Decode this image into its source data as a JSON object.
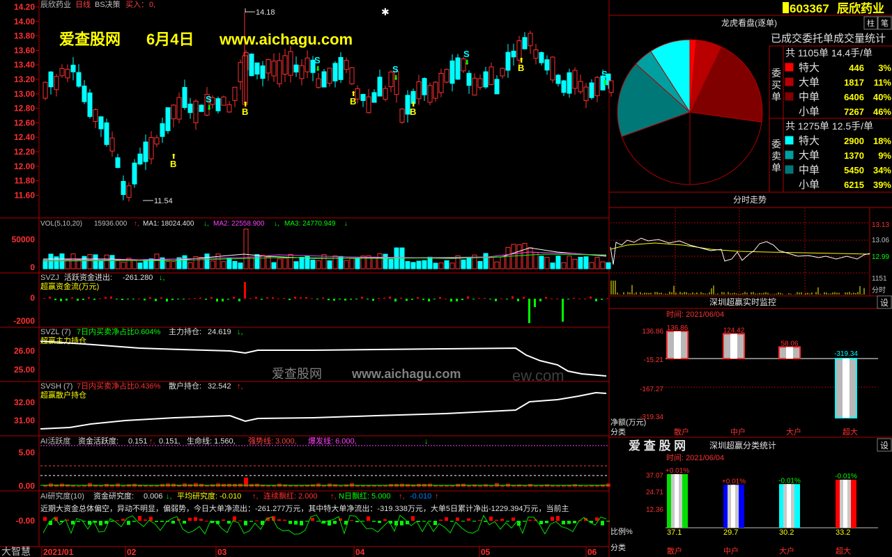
{
  "stock": {
    "name": "辰欣药业",
    "code": "603367",
    "title_name": "辰欣药业",
    "period": "日线",
    "strategy": "BS决策",
    "buy_label": "买入：",
    "buy_value": "0,"
  },
  "watermark": {
    "site": "爱查股网",
    "date": "6月4日",
    "url": "www.aichagu.com",
    "center_site": "爱查股网",
    "center_url": "www.aichagu.com",
    "center_suffix": "ew.com",
    "logo": "爱 查 股 网"
  },
  "price_axis": [
    "14.20",
    "14.00",
    "13.80",
    "13.60",
    "13.40",
    "13.20",
    "13.00",
    "12.80",
    "12.60",
    "12.40",
    "12.20",
    "12.00",
    "11.80",
    "11.60"
  ],
  "price_high_label": "14.18",
  "price_low_label": "11.54",
  "vol_header": {
    "title": "VOL(5,10,20)",
    "value": "15936.000",
    "ma1": "MA1: 18024.400",
    "ma2": "MA2: 22558.900",
    "ma3": "MA3: 24770.949"
  },
  "vol_axis": [
    "50000",
    "0"
  ],
  "svzj": {
    "title": "SVZJ",
    "label": "活跃资金进出:",
    "value": "-261.280",
    "subtitle": "超赢资金流(万元)",
    "axis": [
      "0",
      "-2000"
    ]
  },
  "svzl": {
    "title": "SVZL (7)",
    "ratio": "7日内买卖净占比0.604%",
    "label": "主力持仓:",
    "value": "24.619",
    "subtitle": "超赢主力持仓",
    "axis": [
      "26.00",
      "25.00"
    ]
  },
  "svsh": {
    "title": "SVSH (7)",
    "ratio": "7日内买卖净占比0.436%",
    "label": "散户持仓:",
    "value": "32.542",
    "subtitle": "超赢散户持仓",
    "axis": [
      "32.00",
      "31.00"
    ]
  },
  "ai_active": {
    "title": "AI活跃度",
    "label": "资金活跃度:",
    "v1": "0.151",
    "v2": "0.151,",
    "life": "生命线: 1.560,",
    "strong": "强势线: 3.000,",
    "burst": "爆发线: 6.000,",
    "axis": [
      "5.00",
      "0.00"
    ]
  },
  "ai_research": {
    "title": "AI研究度(10)",
    "label": "资金研究度:",
    "v1": "0.006",
    "avg": "平均研究度: -0.010",
    "red": "连续飘红: 2.000",
    "nred": "N日飘红: 5.000",
    "nval": "-0.010",
    "summary": "近期大资金总体偏空，异动不明显，偏弱势，今日大单净流出：-261.277万元，其中特大单净流出：-319.338万元，大单5日累计净出-1229.394万元，当前主",
    "axis": [
      "-0.00"
    ]
  },
  "x_axis": [
    "2021/01",
    "02",
    "03",
    "04",
    "05",
    "06"
  ],
  "bottom_label": "大智慧",
  "right": {
    "tab1": "柱",
    "tab2": "笔",
    "panel_title": "龙虎看盘(逐单)",
    "panel_sub": "已成交委托单成交量统计",
    "buy_side": "委买单",
    "sell_side": "委卖单",
    "buy_total": "共 1105单 14.4手/单",
    "sell_total": "共 1275单 12.5手/单",
    "buy_rows": [
      {
        "label": "特大",
        "count": "446",
        "pct": "3%",
        "color": "#ff0000"
      },
      {
        "label": "大单",
        "count": "1817",
        "pct": "11%",
        "color": "#b80000"
      },
      {
        "label": "中单",
        "count": "6406",
        "pct": "40%",
        "color": "#800000"
      },
      {
        "label": "小单",
        "count": "7267",
        "pct": "46%",
        "color": "#000000"
      }
    ],
    "sell_rows": [
      {
        "label": "特大",
        "count": "2900",
        "pct": "18%",
        "color": "#00ffff"
      },
      {
        "label": "大单",
        "count": "1370",
        "pct": "9%",
        "color": "#00a0a0"
      },
      {
        "label": "中单",
        "count": "5450",
        "pct": "34%",
        "color": "#007878"
      },
      {
        "label": "小单",
        "count": "6215",
        "pct": "39%",
        "color": "#000000"
      }
    ],
    "intraday_title": "分时走势",
    "intraday_axis": [
      "13.13",
      "13.06",
      "12.99",
      "1151",
      "分时"
    ],
    "realtime_title": "深圳超赢实时监控",
    "setting": "设",
    "realtime_time": "时间: 2021/06/04",
    "realtime_axis": [
      "136.86",
      "-15.21",
      "-167.27",
      "-319.34"
    ],
    "realtime_unit": "净额(万元)",
    "realtime_cat_label": "分类",
    "realtime_values": [
      {
        "label": "散户",
        "value": 136.86,
        "text": "136.86"
      },
      {
        "label": "中户",
        "value": 124.42,
        "text": "124.42"
      },
      {
        "label": "大户",
        "value": 58.06,
        "text": "58.06"
      },
      {
        "label": "超大",
        "value": -319.34,
        "text": "-319.34"
      }
    ],
    "class_title": "深圳超赢分类统计",
    "class_time": "时间: 2021/06/04",
    "class_axis": [
      "37.07",
      "24.71",
      "12.36"
    ],
    "class_ratio_label": "比例%",
    "class_cat_label": "分类",
    "class_values": [
      {
        "label": "散户",
        "value": 37.1,
        "text": "37.1",
        "change": "+0.01%",
        "color": "#00e000"
      },
      {
        "label": "中户",
        "value": 29.7,
        "text": "29.7",
        "change": "+0.01%",
        "color": "#0000ff"
      },
      {
        "label": "大户",
        "value": 30.2,
        "text": "30.2",
        "change": "-0.01%",
        "color": "#00ffff"
      },
      {
        "label": "超大",
        "value": 33.2,
        "text": "33.2",
        "change": "-0.01%",
        "color": "#ff0000"
      }
    ]
  }
}
